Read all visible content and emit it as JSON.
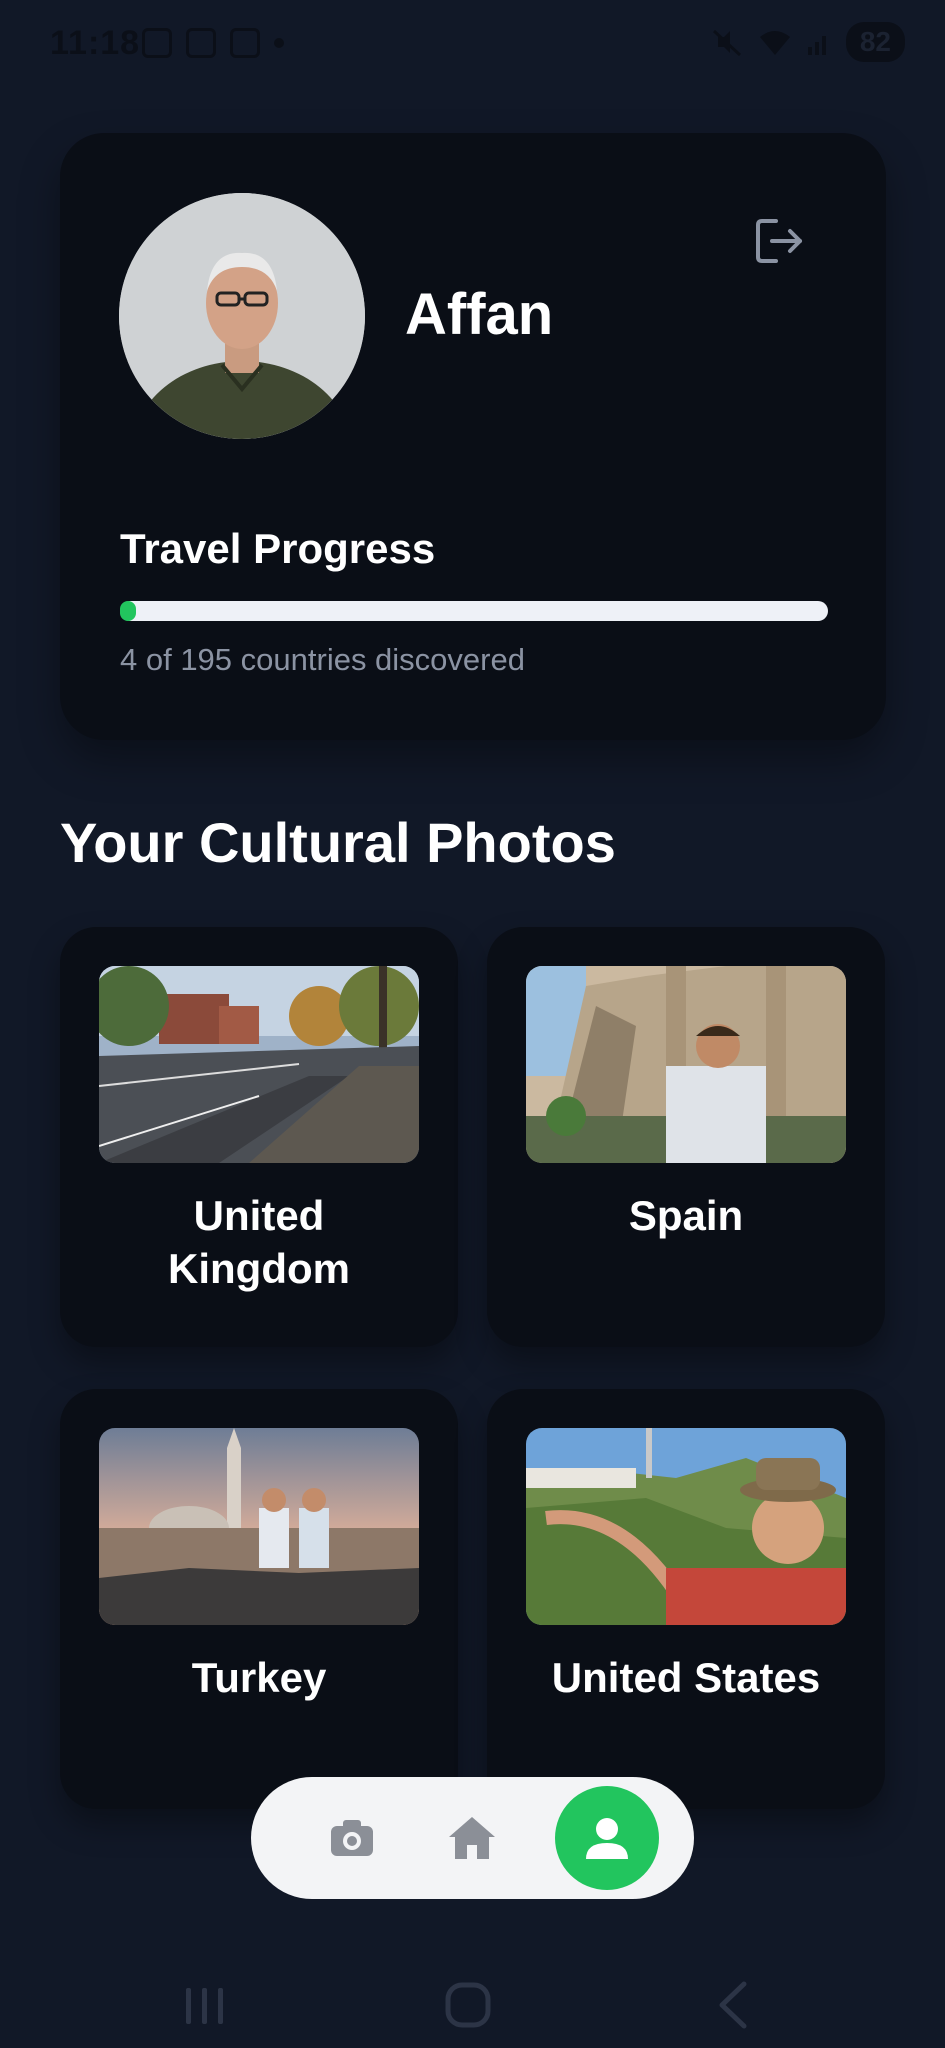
{
  "status_bar": {
    "time": "11:18",
    "battery": "82",
    "icons": [
      "screenshot-icon",
      "app-icon",
      "app-icon-2",
      "notification-dot",
      "mute-icon",
      "wifi-icon",
      "signal-icon",
      "battery-icon"
    ]
  },
  "profile": {
    "name": "Affan",
    "logout_icon": "logout-icon"
  },
  "travel_progress": {
    "title": "Travel Progress",
    "discovered": 4,
    "total": 195,
    "caption": "4 of 195 countries discovered"
  },
  "photos_section": {
    "title": "Your Cultural Photos",
    "items": [
      {
        "label_line1": "United",
        "label_line2": "Kingdom"
      },
      {
        "label_line1": "Spain",
        "label_line2": ""
      },
      {
        "label_line1": "Turkey",
        "label_line2": ""
      },
      {
        "label_line1": "United States",
        "label_line2": ""
      }
    ]
  },
  "bottom_nav": {
    "items": [
      "camera-icon",
      "home-icon",
      "profile-icon"
    ],
    "active": "profile-icon",
    "accent": "#22c55e"
  },
  "colors": {
    "background": "#111827",
    "card": "#0a0e16",
    "accent": "#22c55e"
  }
}
